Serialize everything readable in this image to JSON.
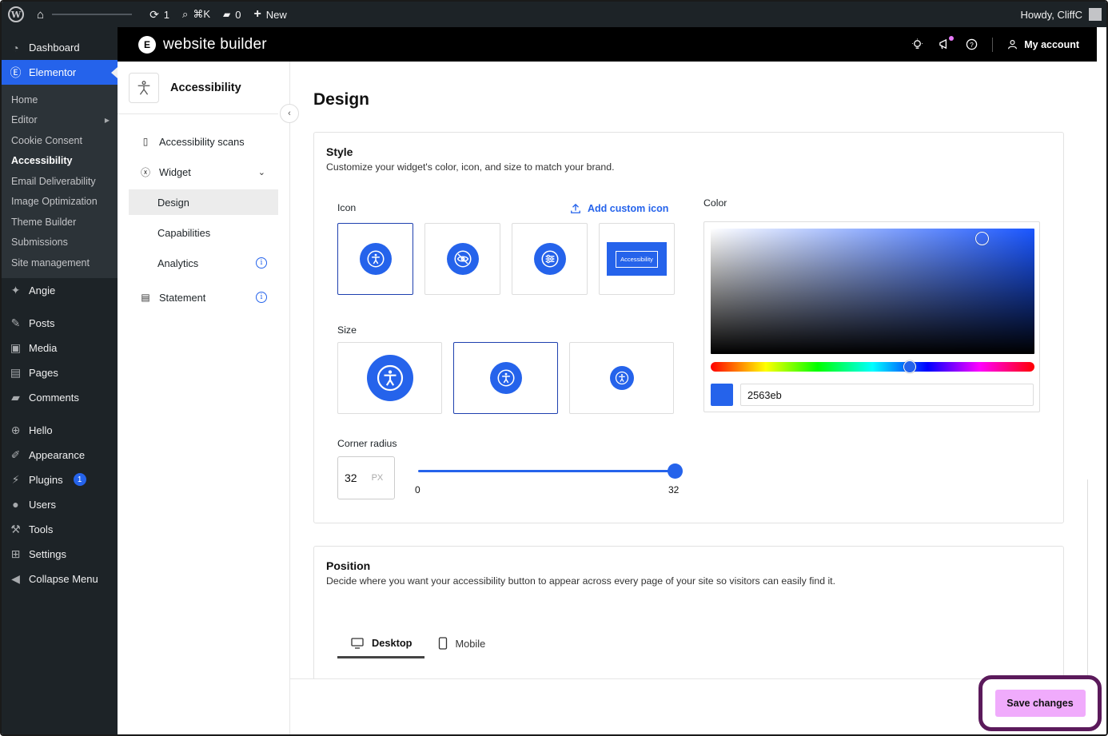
{
  "adminbar": {
    "updates_count": "1",
    "search_shortcut": "⌘K",
    "comments_count": "0",
    "new_label": "New",
    "howdy": "Howdy, CliffC"
  },
  "wp_sidebar": {
    "dashboard": "Dashboard",
    "elementor": "Elementor",
    "submenu": [
      "Home",
      "Editor",
      "Cookie Consent",
      "Accessibility",
      "Email Deliverability",
      "Image Optimization",
      "Theme Builder",
      "Submissions",
      "Site management"
    ],
    "angie": "Angie",
    "posts": "Posts",
    "media": "Media",
    "pages": "Pages",
    "comments": "Comments",
    "hello": "Hello",
    "appearance": "Appearance",
    "plugins": "Plugins",
    "plugins_badge": "1",
    "users": "Users",
    "tools": "Tools",
    "settings": "Settings",
    "collapse": "Collapse Menu"
  },
  "topbar": {
    "title": "website builder",
    "account": "My account"
  },
  "inner_nav": {
    "title": "Accessibility",
    "scans": "Accessibility scans",
    "widget": "Widget",
    "design": "Design",
    "capabilities": "Capabilities",
    "analytics": "Analytics",
    "statement": "Statement"
  },
  "main": {
    "page_title": "Design",
    "style": {
      "title": "Style",
      "description": "Customize your widget's color, icon, and size to match your brand.",
      "icon_label": "Icon",
      "add_custom_icon": "Add custom icon",
      "icon_text_option": "Accessibility",
      "size_label": "Size",
      "color_label": "Color",
      "hex_value": "2563eb",
      "corner_radius_label": "Corner radius",
      "corner_radius_value": "32",
      "corner_radius_unit": "PX",
      "slider_min": "0",
      "slider_max": "32"
    },
    "position": {
      "title": "Position",
      "description": "Decide where you want your accessibility button to appear across every page of your site so visitors can easily find it.",
      "tab_desktop": "Desktop",
      "tab_mobile": "Mobile"
    }
  },
  "footer": {
    "save": "Save changes"
  },
  "colors": {
    "accent": "#2563eb",
    "save_button": "#f0abfc",
    "highlight_ring": "#5b1a5b"
  }
}
